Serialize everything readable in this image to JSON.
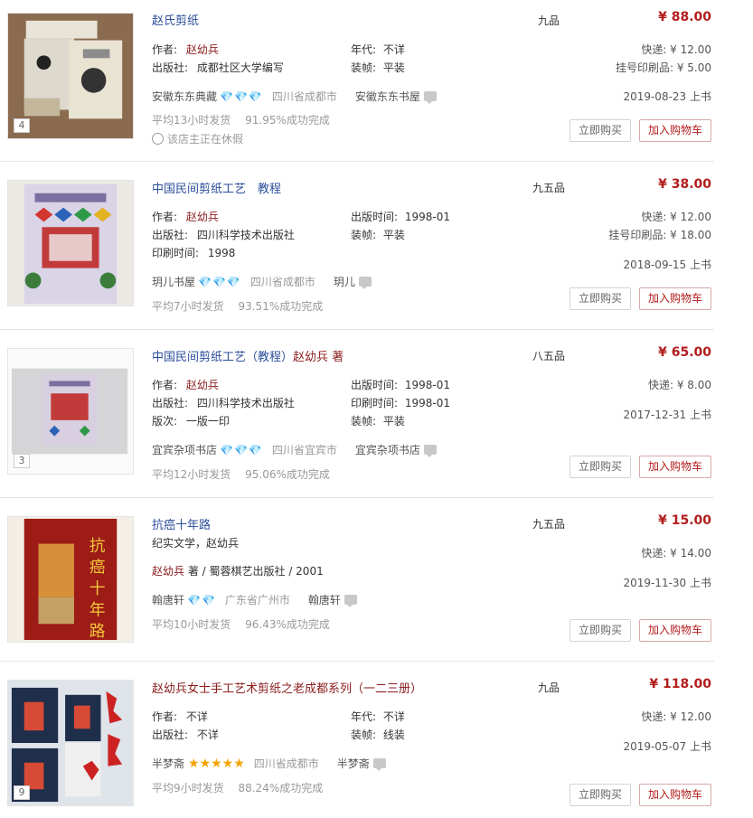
{
  "listings": [
    {
      "title": "赵氏剪纸",
      "condition": "九品",
      "price": "¥ 88.00",
      "image_count": "4",
      "author_label": "作者:",
      "author": "赵幼兵",
      "era_label": "年代:",
      "era": "不详",
      "publisher_label": "出版社:",
      "publisher": "成都社区大学编写",
      "binding_label": "装帧:",
      "binding": "平装",
      "shipping": "快递: ¥ 12.00",
      "shipping2": "挂号印刷品: ¥ 5.00",
      "date": "2019-08-23 上书",
      "shop": "安徽东东典藏",
      "shop_level": "💎💎💎",
      "location": "四川省成都市",
      "seller": "安徽东东书屋",
      "avg_ship": "平均13小时发货",
      "success": "91.95%成功完成",
      "resting": "该店主正在休假",
      "buy_label": "立即购买",
      "cart_label": "加入购物车"
    },
    {
      "title": "中国民间剪纸工艺　教程",
      "condition": "九五品",
      "price": "¥ 38.00",
      "author_label": "作者:",
      "author": "赵幼兵",
      "pubtime_label": "出版时间:",
      "pubtime": "1998-01",
      "publisher_label": "出版社:",
      "publisher": "四川科学技术出版社",
      "binding_label": "装帧:",
      "binding": "平装",
      "printtime_label": "印刷时间:",
      "printtime": "1998",
      "shipping": "快递: ¥ 12.00",
      "shipping2": "挂号印刷品: ¥ 18.00",
      "date": "2018-09-15 上书",
      "shop": "玥儿书屋",
      "shop_level": "💎💎💎",
      "location": "四川省成都市",
      "seller": "玥儿",
      "avg_ship": "平均7小时发货",
      "success": "93.51%成功完成",
      "buy_label": "立即购买",
      "cart_label": "加入购物车"
    },
    {
      "title_main": "中国民间剪纸工艺（教程）",
      "title_author": "赵幼兵 著",
      "condition": "八五品",
      "price": "¥ 65.00",
      "image_count": "3",
      "author_label": "作者:",
      "author": "赵幼兵",
      "pubtime_label": "出版时间:",
      "pubtime": "1998-01",
      "publisher_label": "出版社:",
      "publisher": "四川科学技术出版社",
      "printtime_label": "印刷时间:",
      "printtime": "1998-01",
      "edition_label": "版次:",
      "edition": "一版一印",
      "binding_label": "装帧:",
      "binding": "平装",
      "shipping": "快递: ¥ 8.00",
      "date": "2017-12-31 上书",
      "shop": "宜宾杂项书店",
      "shop_level": "💎💎💎",
      "location": "四川省宜宾市",
      "seller": "宜宾杂项书店",
      "avg_ship": "平均12小时发货",
      "success": "95.06%成功完成",
      "buy_label": "立即购买",
      "cart_label": "加入购物车"
    },
    {
      "title": "抗癌十年路",
      "condition": "九五品",
      "price": "¥ 15.00",
      "subtitle": "纪实文学，赵幼兵",
      "author_link": "赵幼兵",
      "pub_line": " 著 / 蜀蓉棋艺出版社 / 2001",
      "shipping": "快递: ¥ 14.00",
      "date": "2019-11-30 上书",
      "shop": "翰唐轩",
      "shop_level": "💎💎",
      "location": "广东省广州市",
      "seller": "翰唐轩",
      "avg_ship": "平均10小时发货",
      "success": "96.43%成功完成",
      "cover_text": "抗癌十年路",
      "buy_label": "立即购买",
      "cart_label": "加入购物车"
    },
    {
      "title": "赵幼兵女士手工艺术剪纸之老成都系列（一二三册）",
      "condition": "九品",
      "price": "¥ 118.00",
      "image_count": "9",
      "author_label": "作者:",
      "author": "不详",
      "era_label": "年代:",
      "era": "不详",
      "publisher_label": "出版社:",
      "publisher": "不详",
      "binding_label": "装帧:",
      "binding": "线装",
      "shipping": "快递: ¥ 12.00",
      "date": "2019-05-07 上书",
      "shop": "半梦斋",
      "shop_level": "★★★★★",
      "location": "四川省成都市",
      "seller": "半梦斋",
      "avg_ship": "平均9小时发货",
      "success": "88.24%成功完成",
      "buy_label": "立即购买",
      "cart_label": "加入购物车"
    }
  ],
  "colors": {
    "price": "#b31d1d",
    "title": "#2c4e9a",
    "diamond": "#3fb3e8",
    "star": "#f5a300"
  }
}
